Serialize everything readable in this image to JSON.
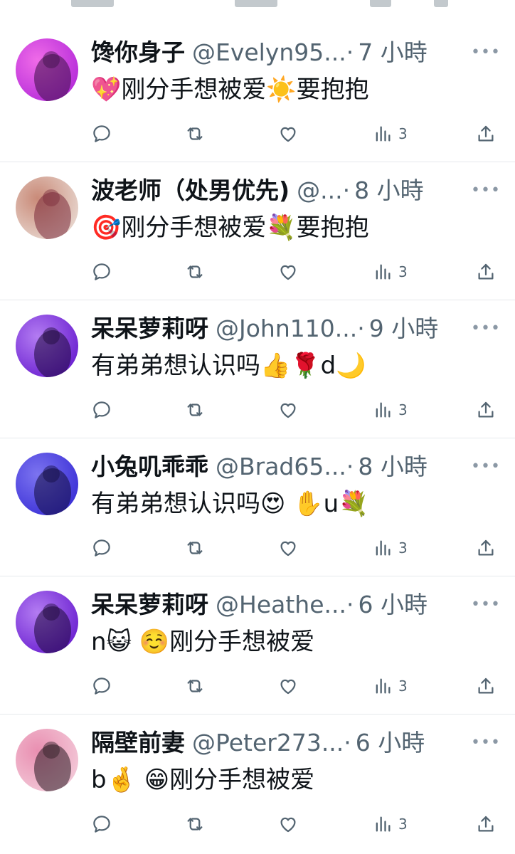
{
  "feed": {
    "posts": [
      {
        "display_name": "馋你身子",
        "handle": "@Evelyn95...",
        "separator": "·",
        "time": "7 小時",
        "text": "💖刚分手想被爱☀️要抱抱",
        "views": "3",
        "avatar": {
          "bg": "#b42bd9",
          "accent": "#f06be8",
          "shadow": "#3a0f45"
        }
      },
      {
        "display_name": "波老师（处男优先)",
        "handle": "@...",
        "separator": "·",
        "time": "8 小時",
        "text": "🎯刚分手想被爱💐要抱抱",
        "views": "3",
        "avatar": {
          "bg": "#e8d7cf",
          "accent": "#c98a78",
          "shadow": "#7a2a3a"
        }
      },
      {
        "display_name": "呆呆萝莉呀",
        "handle": "@John110...",
        "separator": "·",
        "time": "9 小時",
        "text": "有弟弟想认识吗👍🌹d🌙",
        "views": "3",
        "avatar": {
          "bg": "#6a1fd0",
          "accent": "#b37cf2",
          "shadow": "#1c0838"
        }
      },
      {
        "display_name": "小兔叽乖乖",
        "handle": "@Brad65...",
        "separator": "·",
        "time": "8 小時",
        "text": "有弟弟想认识吗😍 ✋u💐",
        "views": "3",
        "avatar": {
          "bg": "#3a2fd6",
          "accent": "#7c74f0",
          "shadow": "#120c3d"
        }
      },
      {
        "display_name": "呆呆萝莉呀",
        "handle": "@Heathe...",
        "separator": "·",
        "time": "6 小時",
        "text": "n😺 ☺️刚分手想被爱",
        "views": "3",
        "avatar": {
          "bg": "#6a1fd0",
          "accent": "#b37cf2",
          "shadow": "#1c0838"
        }
      },
      {
        "display_name": "隔壁前妻",
        "handle": "@Peter273...",
        "separator": "·",
        "time": "6 小時",
        "text": "b🤞 😁刚分手想被爱",
        "views": "3",
        "avatar": {
          "bg": "#f3c9d8",
          "accent": "#e98fb1",
          "shadow": "#2a1a22"
        }
      }
    ]
  },
  "icons": {
    "more": "more-horizontal-icon",
    "reply": "reply-icon",
    "retweet": "retweet-icon",
    "like": "heart-icon",
    "views": "views-bar-chart-icon",
    "share": "share-icon"
  },
  "colors": {
    "text_primary": "#0f1419",
    "text_secondary": "#536471",
    "divider": "#e6e9ec"
  }
}
